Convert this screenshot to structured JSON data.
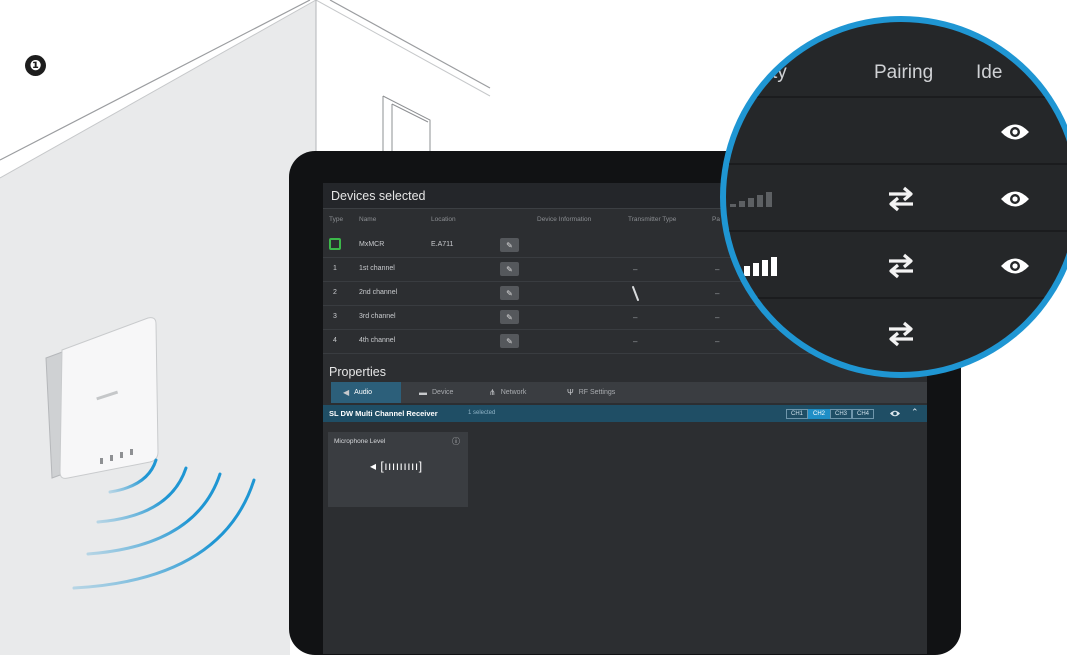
{
  "step": {
    "number": "❶"
  },
  "devices_panel": {
    "title": "Devices selected",
    "columns": [
      "Type",
      "Name",
      "Location",
      "Device Information",
      "Transmitter Type",
      "Pa"
    ],
    "device": {
      "name": "MxMCR",
      "location": "E.A711"
    },
    "channels": [
      {
        "index": "1",
        "name": "1st channel",
        "transmitter": "–",
        "pairing": "–"
      },
      {
        "index": "2",
        "name": "2nd channel",
        "transmitter": "",
        "pairing": "–"
      },
      {
        "index": "3",
        "name": "3rd channel",
        "transmitter": "–",
        "pairing": "–"
      },
      {
        "index": "4",
        "name": "4th channel",
        "transmitter": "–",
        "pairing": "–"
      }
    ]
  },
  "properties": {
    "title": "Properties",
    "tabs": [
      {
        "label": "Audio",
        "icon": "speaker-icon",
        "active": true
      },
      {
        "label": "Device",
        "icon": "device-icon",
        "active": false
      },
      {
        "label": "Network",
        "icon": "network-icon",
        "active": false
      },
      {
        "label": "RF Settings",
        "icon": "antenna-icon",
        "active": false
      }
    ],
    "receiver": {
      "title": "SL DW Multi Channel Receiver",
      "subtitle": "1 selected",
      "channels": [
        {
          "label": "CH1",
          "active": false
        },
        {
          "label": "CH2",
          "active": true
        },
        {
          "label": "CH3",
          "active": false
        },
        {
          "label": "CH4",
          "active": false
        }
      ]
    },
    "mic_level": {
      "label": "Microphone Level",
      "meter": "◂ [ııııııııı]"
    }
  },
  "magnifier": {
    "headers": [
      "ality",
      "Pairing",
      "Ide"
    ]
  },
  "colors": {
    "accent_blue": "#1f96d3",
    "active_tab": "#2c5f7a",
    "receiver_bar": "#1f4e65",
    "device_ok_green": "#3cb84a"
  }
}
